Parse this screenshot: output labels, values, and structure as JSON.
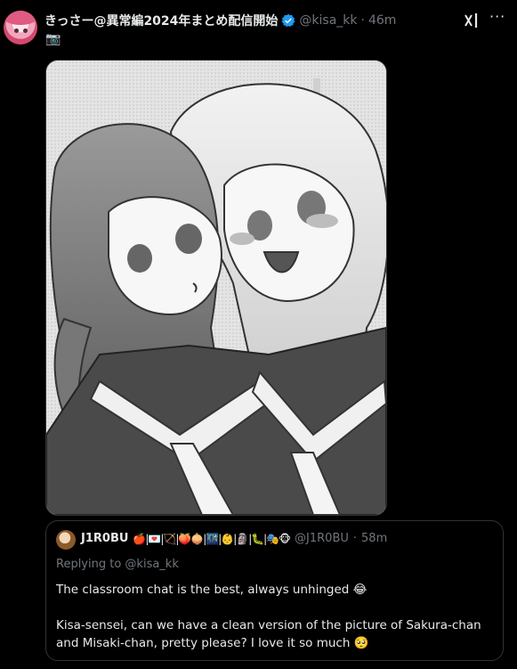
{
  "post": {
    "display_name": "きっさー@異常編2024年まとめ配信開始",
    "handle": "@kisa_kk",
    "separator": "·",
    "time": "46m",
    "body_emoji": "📷",
    "verified_icon": "verified-badge-icon",
    "more_icon": "more-options-icon",
    "grok_icon": "grok-icon"
  },
  "quote": {
    "display_name": "J1R0BU",
    "emojis": "🍎|💌|🏹|🍑🧅|🌃|👶|🗿|🐛|🎭🐵",
    "handle": "@J1R0BU",
    "separator": "·",
    "time": "58m",
    "replying_to": "Replying to @kisa_kk",
    "text": "The classroom chat is the best, always unhinged 😂\n\nKisa-sensei, can we have a clean version of the picture of Sakura-chan and Misaki-chan, pretty please? I love it so much 🥺"
  },
  "colors": {
    "background": "#000000",
    "text_primary": "#e7e9ea",
    "text_secondary": "#71767b",
    "border": "#2f3336",
    "verified": "#1d9bf0"
  }
}
